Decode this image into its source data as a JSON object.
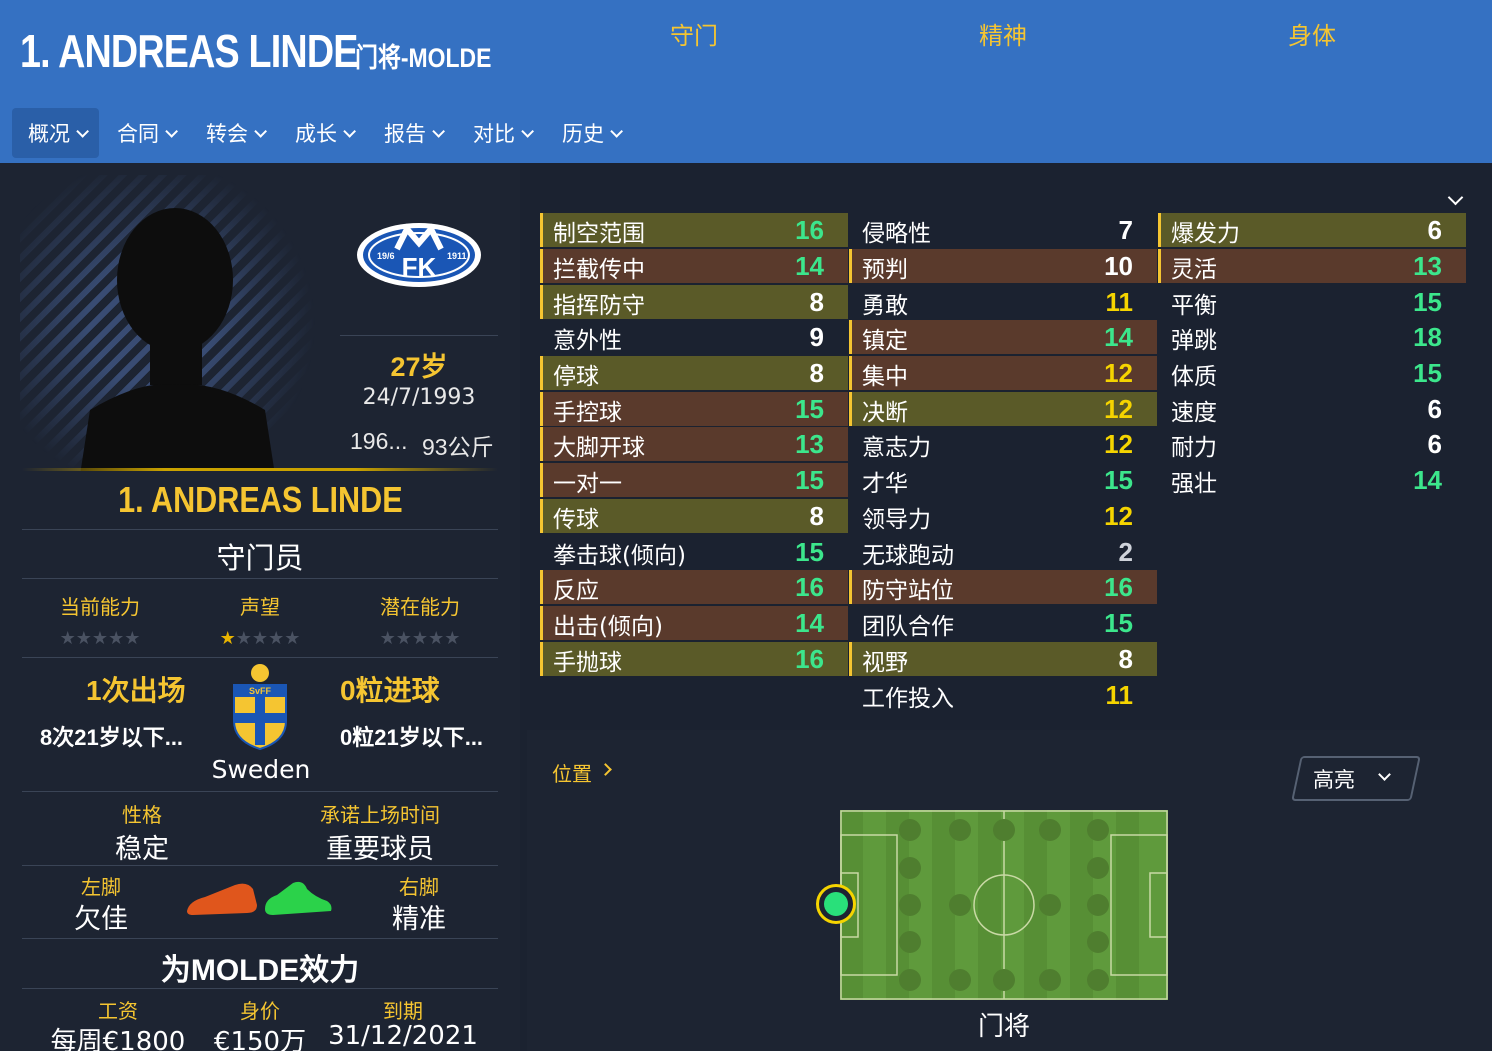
{
  "header": {
    "title": "1. ANDREAS LINDE",
    "subtitle": "门将-MOLDE",
    "tabs": [
      {
        "label": "概况"
      },
      {
        "label": "合同"
      },
      {
        "label": "转会"
      },
      {
        "label": "成长"
      },
      {
        "label": "报告"
      },
      {
        "label": "对比"
      },
      {
        "label": "历史"
      }
    ]
  },
  "profile": {
    "age": "27岁",
    "dob": "24/7/1993",
    "height": "196...",
    "weight": "93公斤",
    "name": "1. ANDREAS LINDE",
    "role": "守门员",
    "current_ability": {
      "label": "当前能力",
      "stars": 0
    },
    "reputation": {
      "label": "声望",
      "stars": 0.5
    },
    "potential_ability": {
      "label": "潜在能力",
      "stars": 0
    },
    "appearances": "1次出场",
    "u21_appearances": "8次21岁以下...",
    "goals": "0粒进球",
    "u21_goals": "0粒21岁以下...",
    "nation": "Sweden",
    "personality_label": "性格",
    "personality": "稳定",
    "playing_time_label": "承诺上场时间",
    "playing_time": "重要球员",
    "left_foot_label": "左脚",
    "left_foot": "欠佳",
    "right_foot_label": "右脚",
    "right_foot": "精准",
    "club_line": "为MOLDE效力",
    "wage_label": "工资",
    "wage": "每周€1800",
    "value_label": "身价",
    "value": "€150万",
    "expires_label": "到期",
    "expires": "31/12/2021"
  },
  "attributes": {
    "goalkeeping": {
      "header": "守门",
      "rows": [
        {
          "name": "制空范围",
          "value": "16"
        },
        {
          "name": "拦截传中",
          "value": "14"
        },
        {
          "name": "指挥防守",
          "value": "8"
        },
        {
          "name": "意外性",
          "value": "9"
        },
        {
          "name": "停球",
          "value": "8"
        },
        {
          "name": "手控球",
          "value": "15"
        },
        {
          "name": "大脚开球",
          "value": "13"
        },
        {
          "name": "一对一",
          "value": "15"
        },
        {
          "name": "传球",
          "value": "8"
        },
        {
          "name": "拳击球(倾向)",
          "value": "15"
        },
        {
          "name": "反应",
          "value": "16"
        },
        {
          "name": "出击(倾向)",
          "value": "14"
        },
        {
          "name": "手抛球",
          "value": "16"
        }
      ]
    },
    "mental": {
      "header": "精神",
      "rows": [
        {
          "name": "侵略性",
          "value": "7"
        },
        {
          "name": "预判",
          "value": "10"
        },
        {
          "name": "勇敢",
          "value": "11"
        },
        {
          "name": "镇定",
          "value": "14"
        },
        {
          "name": "集中",
          "value": "12"
        },
        {
          "name": "决断",
          "value": "12"
        },
        {
          "name": "意志力",
          "value": "12"
        },
        {
          "name": "才华",
          "value": "15"
        },
        {
          "name": "领导力",
          "value": "12"
        },
        {
          "name": "无球跑动",
          "value": "2"
        },
        {
          "name": "防守站位",
          "value": "16"
        },
        {
          "name": "团队合作",
          "value": "15"
        },
        {
          "name": "视野",
          "value": "8"
        },
        {
          "name": "工作投入",
          "value": "11"
        }
      ]
    },
    "physical": {
      "header": "身体",
      "rows": [
        {
          "name": "爆发力",
          "value": "6"
        },
        {
          "name": "灵活",
          "value": "13"
        },
        {
          "name": "平衡",
          "value": "15"
        },
        {
          "name": "弹跳",
          "value": "18"
        },
        {
          "name": "体质",
          "value": "15"
        },
        {
          "name": "速度",
          "value": "6"
        },
        {
          "name": "耐力",
          "value": "6"
        },
        {
          "name": "强壮",
          "value": "14"
        }
      ]
    }
  },
  "position": {
    "title": "位置",
    "highlight_button": "高亮",
    "position_name": "门将"
  },
  "colors": {
    "header_bg": "#3571c2",
    "accent_yellow": "#f5c531",
    "value_green": "#3ce68c",
    "pitch_green": "#5f9a3c"
  }
}
